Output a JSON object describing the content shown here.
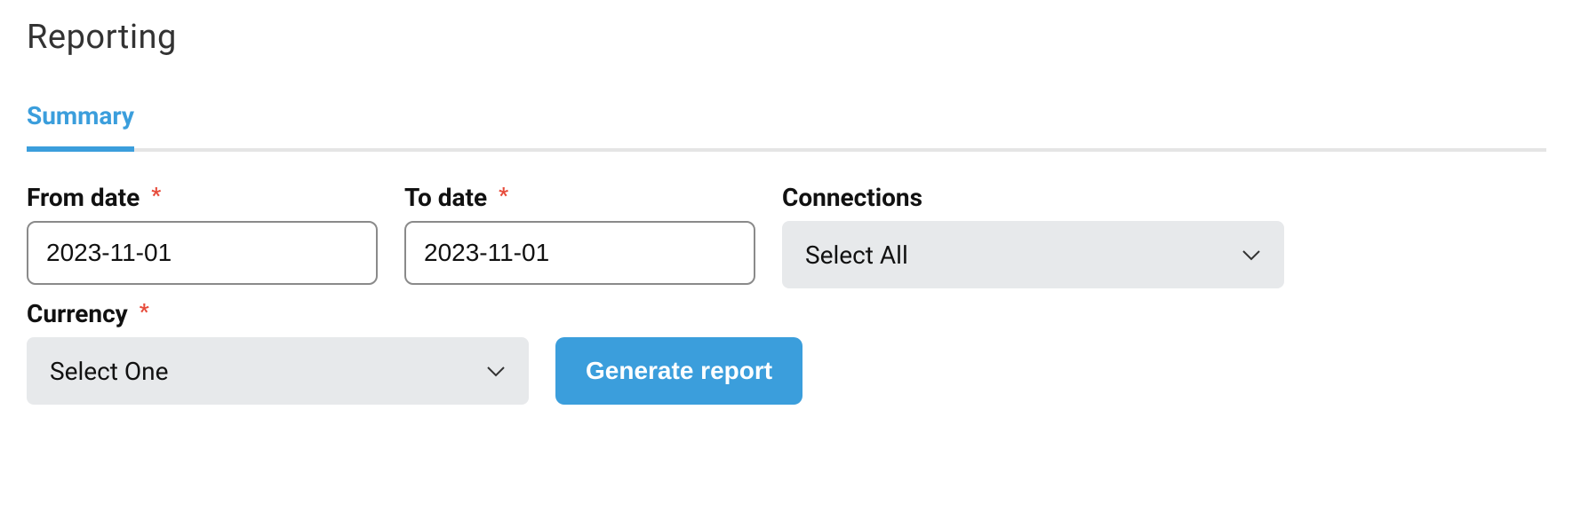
{
  "page": {
    "title": "Reporting"
  },
  "tabs": {
    "summary": "Summary"
  },
  "form": {
    "from_date": {
      "label": "From date",
      "value": "2023-11-01"
    },
    "to_date": {
      "label": "To date",
      "value": "2023-11-01"
    },
    "connections": {
      "label": "Connections",
      "selected": "Select All"
    },
    "currency": {
      "label": "Currency",
      "selected": "Select One"
    },
    "generate_label": "Generate report"
  }
}
